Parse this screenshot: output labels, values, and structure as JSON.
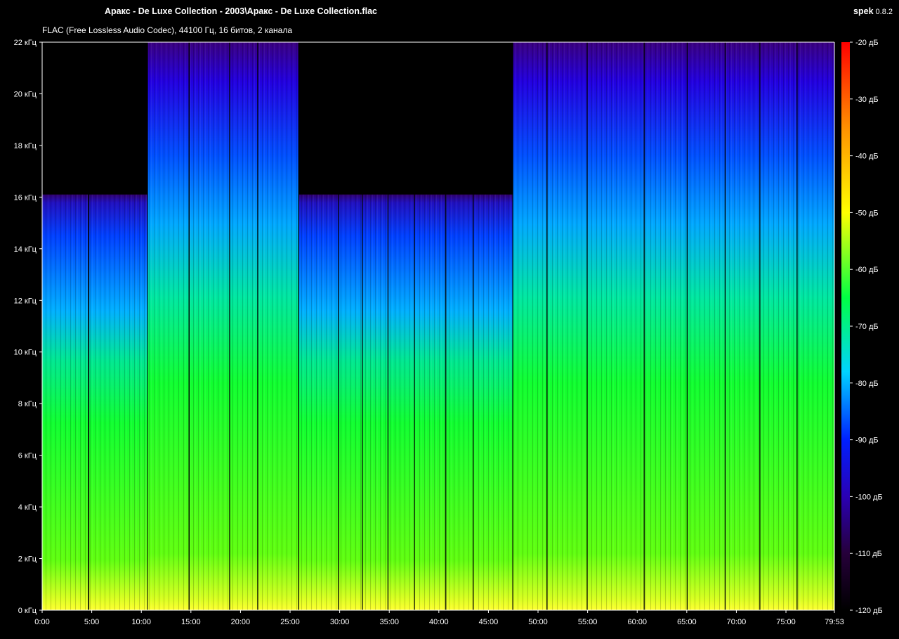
{
  "window": {
    "title": "Аракс - De Luxe Collection - 2003\\Аракс - De Luxe Collection.flac",
    "brand": "spek",
    "version": "0.8.2",
    "subtitle": "FLAC (Free Lossless Audio Codec), 44100 Гц, 16 битов, 2 канала"
  },
  "colors": {
    "background": "#000000",
    "axis": "#ffffff",
    "palette": [
      "#000000",
      "#26003a",
      "#2a00b4",
      "#0020ff",
      "#00d4ff",
      "#00ff44",
      "#ffff00",
      "#ff9000",
      "#ff0000"
    ]
  },
  "chart_data": {
    "type": "heatmap",
    "description_axes": "time vs frequency spectrogram",
    "x_unit": "time (min:sec)",
    "y_unit": "kHz",
    "x_ticks": [
      "0:00",
      "5:00",
      "10:00",
      "15:00",
      "20:00",
      "25:00",
      "30:00",
      "35:00",
      "40:00",
      "45:00",
      "50:00",
      "55:00",
      "60:00",
      "65:00",
      "70:00",
      "75:00",
      "79:53"
    ],
    "y_ticks": [
      "0 кГц",
      "2 кГц",
      "4 кГц",
      "6 кГц",
      "8 кГц",
      "10 кГц",
      "12 кГц",
      "14 кГц",
      "16 кГц",
      "18 кГц",
      "20 кГц",
      "22 кГц"
    ],
    "xlim_seconds": [
      0,
      4793
    ],
    "ylim_khz": [
      0,
      22
    ],
    "colorbar_labels": [
      "-20 дБ",
      "-30 дБ",
      "-40 дБ",
      "-50 дБ",
      "-60 дБ",
      "-70 дБ",
      "-80 дБ",
      "-90 дБ",
      "-100 дБ",
      "-110 дБ",
      "-120 дБ"
    ],
    "colorbar_range_db": [
      -120,
      -20
    ],
    "segments": [
      {
        "start_s": 0,
        "end_s": 278,
        "cutoff_khz": 16.1
      },
      {
        "start_s": 285,
        "end_s": 636,
        "cutoff_khz": 16.1
      },
      {
        "start_s": 640,
        "end_s": 887,
        "cutoff_khz": 22
      },
      {
        "start_s": 892,
        "end_s": 1132,
        "cutoff_khz": 22
      },
      {
        "start_s": 1137,
        "end_s": 1302,
        "cutoff_khz": 22
      },
      {
        "start_s": 1307,
        "end_s": 1550,
        "cutoff_khz": 22
      },
      {
        "start_s": 1555,
        "end_s": 1790,
        "cutoff_khz": 16.1
      },
      {
        "start_s": 1795,
        "end_s": 1935,
        "cutoff_khz": 16.1
      },
      {
        "start_s": 1940,
        "end_s": 2090,
        "cutoff_khz": 16.1
      },
      {
        "start_s": 2095,
        "end_s": 2250,
        "cutoff_khz": 16.1
      },
      {
        "start_s": 2255,
        "end_s": 2440,
        "cutoff_khz": 16.1
      },
      {
        "start_s": 2445,
        "end_s": 2605,
        "cutoff_khz": 16.1
      },
      {
        "start_s": 2610,
        "end_s": 2845,
        "cutoff_khz": 16.1
      },
      {
        "start_s": 2850,
        "end_s": 3052,
        "cutoff_khz": 22
      },
      {
        "start_s": 3057,
        "end_s": 3295,
        "cutoff_khz": 22
      },
      {
        "start_s": 3300,
        "end_s": 3640,
        "cutoff_khz": 22
      },
      {
        "start_s": 3645,
        "end_s": 3900,
        "cutoff_khz": 22
      },
      {
        "start_s": 3905,
        "end_s": 4130,
        "cutoff_khz": 22
      },
      {
        "start_s": 4135,
        "end_s": 4340,
        "cutoff_khz": 22
      },
      {
        "start_s": 4345,
        "end_s": 4565,
        "cutoff_khz": 22
      },
      {
        "start_s": 4570,
        "end_s": 4793,
        "cutoff_khz": 22
      }
    ]
  }
}
